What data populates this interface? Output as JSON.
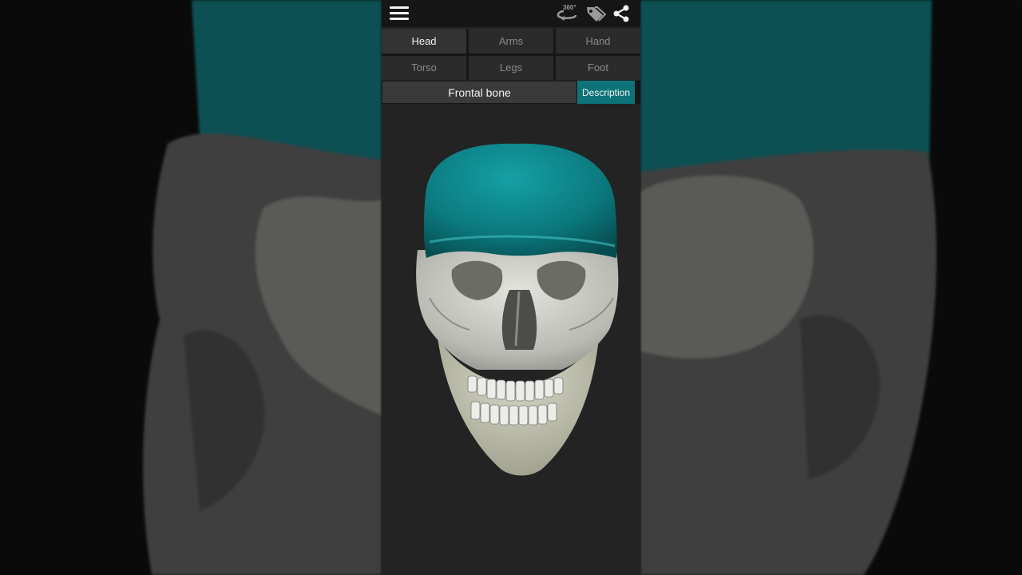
{
  "toolbar": {
    "menu_icon": "hamburger-menu-icon",
    "rotate_icon": "rotate-360-icon",
    "rotate_label": "360°",
    "tags_icon": "tags-icon",
    "share_icon": "share-icon"
  },
  "tabs": [
    {
      "label": "Head",
      "active": true
    },
    {
      "label": "Arms",
      "active": false
    },
    {
      "label": "Hand",
      "active": false
    },
    {
      "label": "Torso",
      "active": false
    },
    {
      "label": "Legs",
      "active": false
    },
    {
      "label": "Foot",
      "active": false
    }
  ],
  "selection": {
    "bone_name": "Frontal bone",
    "description_label": "Description"
  },
  "colors": {
    "highlight": "#0d7378",
    "bone": "#c9c9c4",
    "background": "#232323"
  }
}
